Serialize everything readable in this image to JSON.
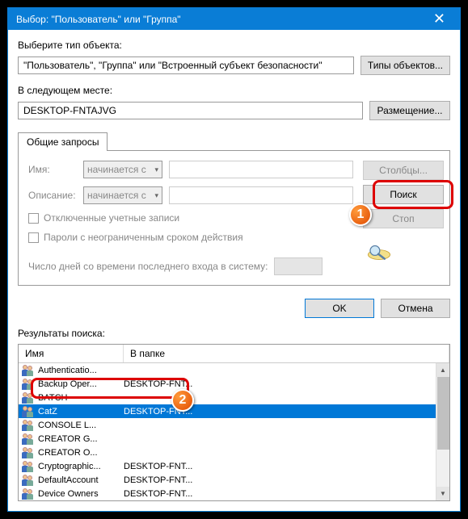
{
  "titlebar": {
    "text": "Выбор: \"Пользователь\" или \"Группа\""
  },
  "section1": {
    "label": "Выберите тип объекта:",
    "value": "\"Пользователь\", \"Группа\" или \"Встроенный субъект безопасности\"",
    "button": "Типы объектов..."
  },
  "section2": {
    "label": "В следующем месте:",
    "value": "DESKTOP-FNTAJVG",
    "button": "Размещение..."
  },
  "tab": {
    "title": "Общие запросы",
    "name_label": "Имя:",
    "desc_label": "Описание:",
    "combo_value": "начинается с",
    "chk1": "Отключенные учетные записи",
    "chk2": "Пароли с неограниченным сроком действия",
    "days_label": "Число дней со времени последнего входа в систему:",
    "btn_columns": "Столбцы...",
    "btn_search": "Поиск",
    "btn_stop": "Стоп"
  },
  "footer": {
    "ok": "OK",
    "cancel": "Отмена"
  },
  "results": {
    "label": "Результаты поиска:",
    "col_name": "Имя",
    "col_folder": "В папке",
    "rows": [
      {
        "name": "Authenticatio...",
        "folder": ""
      },
      {
        "name": "Backup Oper...",
        "folder": "DESKTOP-FNT..."
      },
      {
        "name": "BATCH",
        "folder": ""
      },
      {
        "name": "CatZ",
        "folder": "DESKTOP-FNT...",
        "selected": true
      },
      {
        "name": "CONSOLE L...",
        "folder": ""
      },
      {
        "name": "CREATOR G...",
        "folder": ""
      },
      {
        "name": "CREATOR O...",
        "folder": ""
      },
      {
        "name": "Cryptographic...",
        "folder": "DESKTOP-FNT..."
      },
      {
        "name": "DefaultAccount",
        "folder": "DESKTOP-FNT..."
      },
      {
        "name": "Device Owners",
        "folder": "DESKTOP-FNT..."
      }
    ]
  },
  "annotations": {
    "badge1": "1",
    "badge2": "2"
  }
}
